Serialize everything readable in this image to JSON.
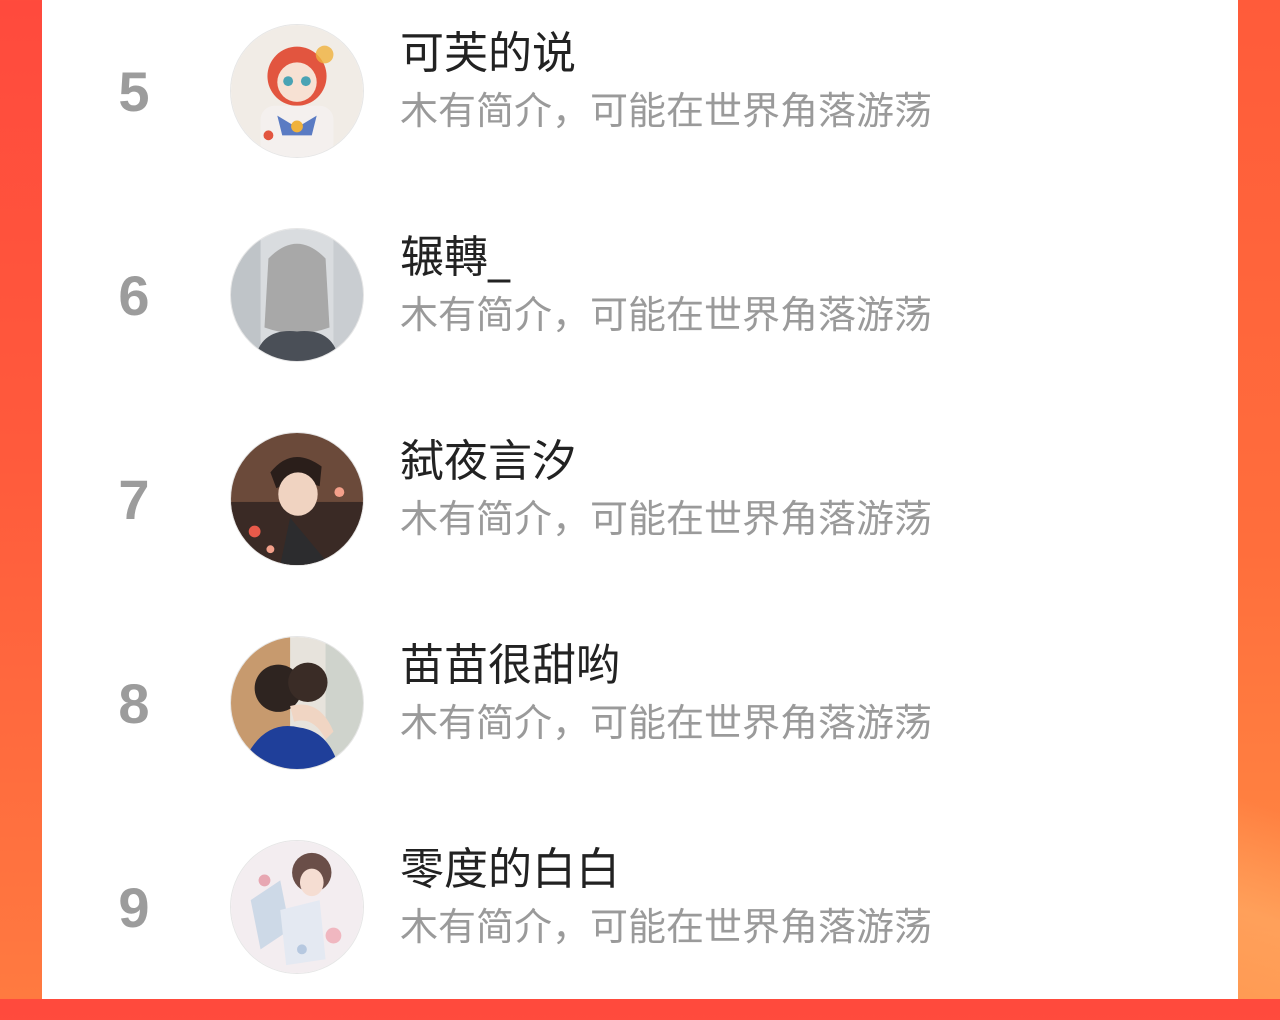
{
  "theme": {
    "accent": "#ff5a3c",
    "panel_bg": "#ffffff",
    "rank_color": "#9c9c9c",
    "name_color": "#222222",
    "bio_color": "#9a9a9a"
  },
  "ranking": {
    "items": [
      {
        "rank": "5",
        "name": "可芙的说",
        "bio": "木有简介，可能在世界角落游荡",
        "avatar": "anime-girl-avatar"
      },
      {
        "rank": "6",
        "name": "辗轉_",
        "bio": "木有简介，可能在世界角落游荡",
        "avatar": "grey-hair-back-avatar"
      },
      {
        "rank": "7",
        "name": "弑夜言汐",
        "bio": "木有简介，可能在世界角落游荡",
        "avatar": "man-portrait-avatar"
      },
      {
        "rank": "8",
        "name": "苗苗很甜哟",
        "bio": "木有简介，可能在世界角落游荡",
        "avatar": "couple-hug-avatar"
      },
      {
        "rank": "9",
        "name": "零度的白白",
        "bio": "木有简介，可能在世界角落游荡",
        "avatar": "pastel-art-avatar"
      }
    ]
  }
}
